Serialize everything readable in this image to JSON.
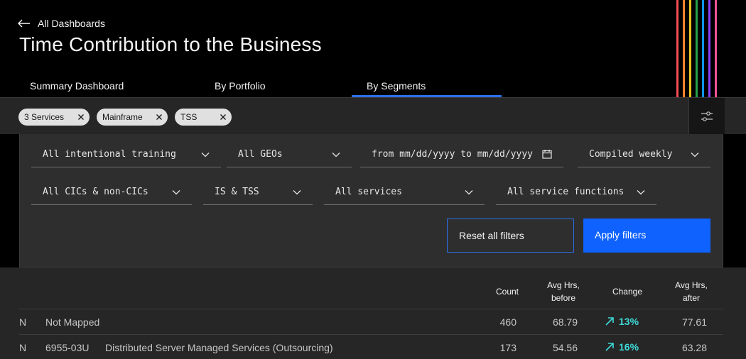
{
  "header": {
    "back_label": "All Dashboards",
    "title": "Time Contribution to the Business",
    "stripe_colors": [
      "#fa4d56",
      "#ff832b",
      "#f1c21b",
      "#24a148",
      "#1192e8",
      "#8a3ffc",
      "#ee5396"
    ]
  },
  "tabs": [
    {
      "label": "Summary Dashboard"
    },
    {
      "label": "By Portfolio"
    },
    {
      "label": "By Segments",
      "selected": true
    }
  ],
  "chips": [
    {
      "label": "3 Services"
    },
    {
      "label": "Mainframe"
    },
    {
      "label": "TSS"
    }
  ],
  "filters": {
    "training": "All intentional training",
    "geo": "All GEOs",
    "date_range": "from mm/dd/yyyy to mm/dd/yyyy",
    "frequency": "Compiled weekly",
    "cic": "All CICs & non-CICs",
    "segment": "IS & TSS",
    "services": "All services",
    "service_functions": "All service functions",
    "reset_label": "Reset all filters",
    "apply_label": "Apply filters"
  },
  "table": {
    "columns": {
      "count": "Count",
      "avg_before_1": "Avg Hrs,",
      "avg_before_2": "before",
      "change": "Change",
      "avg_after_1": "Avg Hrs,",
      "avg_after_2": "after"
    },
    "rows": [
      {
        "flag": "N",
        "code": "",
        "name": "Not Mapped",
        "count": "460",
        "avg_before": "68.79",
        "change": "13%",
        "avg_after": "77.61"
      },
      {
        "flag": "N",
        "code": "6955-03U",
        "name": "Distributed Server Managed Services (Outsourcing)",
        "count": "173",
        "avg_before": "54.56",
        "change": "16%",
        "avg_after": "63.28"
      }
    ]
  },
  "colors": {
    "accent": "#0f62fe",
    "tab_underline": "#2d6fea",
    "positive_change": "#3ddbd9"
  }
}
